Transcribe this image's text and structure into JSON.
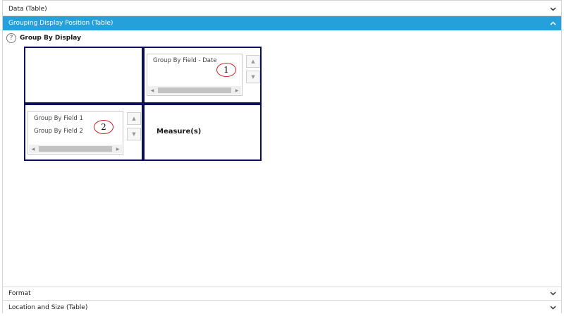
{
  "panels": {
    "data": {
      "label": "Data (Table)",
      "chevron": "chevron-down-icon"
    },
    "grouping": {
      "label": "Grouping Display Position (Table)",
      "chevron": "chevron-up-icon"
    },
    "format": {
      "label": "Format",
      "chevron": "chevron-down-icon"
    },
    "location": {
      "label": "Location and Size (Table)",
      "chevron": "chevron-down-icon"
    }
  },
  "grouping": {
    "help_icon": "help-circle-icon",
    "help_glyph": "?",
    "section_label": "Group By Display",
    "columns_list": {
      "items": [
        "Group By Field - Date"
      ],
      "annotation": "1"
    },
    "rows_list": {
      "items": [
        "Group By Field 1",
        "Group By Field 2"
      ],
      "annotation": "2"
    },
    "measures_label": "Measure(s)"
  },
  "colors": {
    "active_header": "#26a0da",
    "cell_border": "#0c0c5e",
    "annotation_ring": "#d21d1d"
  }
}
